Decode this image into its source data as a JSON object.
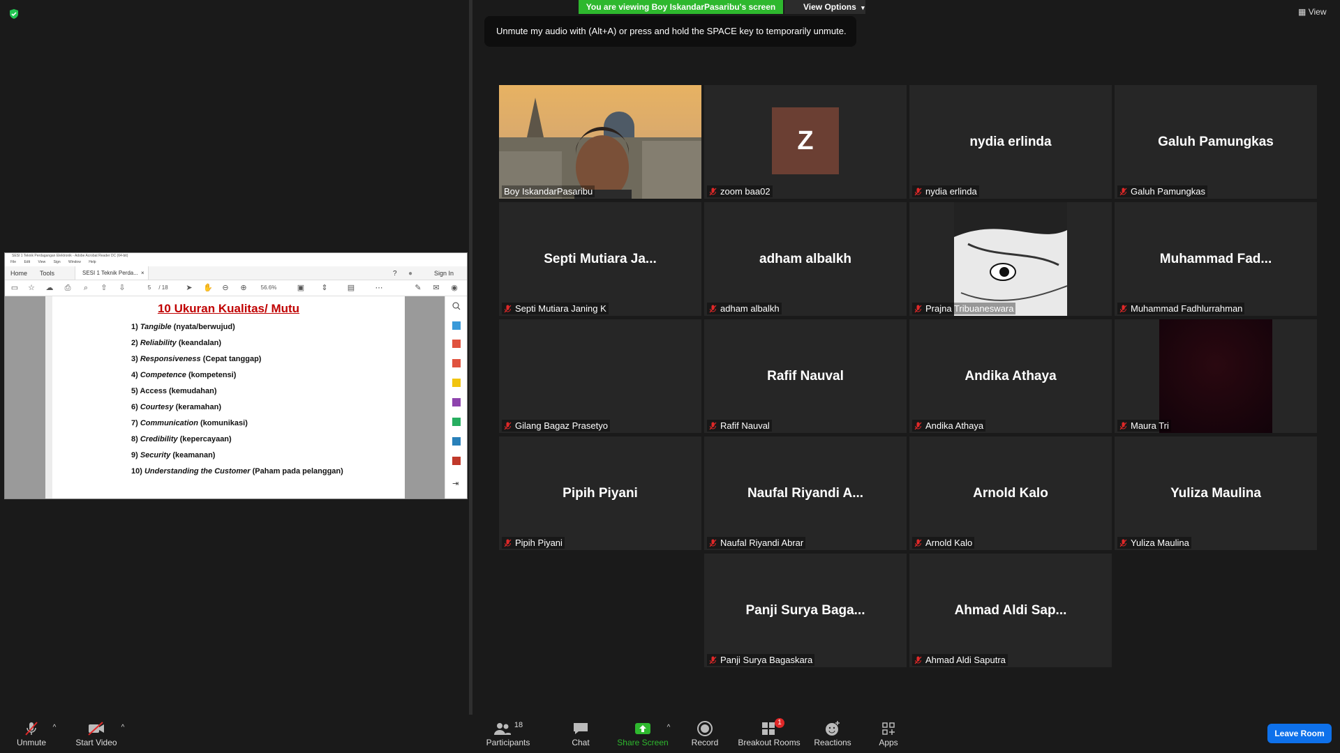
{
  "banner": {
    "viewing": "You are viewing Boy IskandarPasaribu's screen",
    "view_options": "View Options"
  },
  "toast": "Unmute my audio with (Alt+A) or press and hold the SPACE key to temporarily unmute.",
  "view_button": "View",
  "acrobat": {
    "window_title": "SESI 1 Teknik Perdagangan Elektronik - Adobe Acrobat Reader DC (64-bit)",
    "menu": [
      "File",
      "Edit",
      "View",
      "Sign",
      "Window",
      "Help"
    ],
    "tabs": {
      "home": "Home",
      "tools": "Tools",
      "document": "SESI 1 Teknik Perda...",
      "sign_in": "Sign In"
    },
    "page_current": "5",
    "page_total": "/ 18",
    "zoom": "56.6%"
  },
  "pdf": {
    "title": "10 Ukuran Kualitas/ Mutu",
    "items": [
      {
        "num": "1)",
        "term": "Tangible",
        "desc": "(nyata/berwujud)",
        "italic": true
      },
      {
        "num": "2)",
        "term": "Reliability",
        "desc": "(keandalan)",
        "italic": true
      },
      {
        "num": "3)",
        "term": "Responsiveness",
        "desc": "(Cepat tanggap)",
        "italic": true
      },
      {
        "num": "4)",
        "term": "Competence",
        "desc": "(kompetensi)",
        "italic": true
      },
      {
        "num": "5)",
        "term": "Access",
        "desc": "(kemudahan)",
        "italic": false
      },
      {
        "num": "6)",
        "term": "Courtesy",
        "desc": "(keramahan)",
        "italic": true
      },
      {
        "num": "7)",
        "term": "Communication",
        "desc": "(komunikasi)",
        "italic": true
      },
      {
        "num": "8)",
        "term": "Credibility",
        "desc": "(kepercayaan)",
        "italic": true
      },
      {
        "num": "9)",
        "term": "Security",
        "desc": "(keamanan)",
        "italic": true
      },
      {
        "num": "10)",
        "term": "Understanding the Customer",
        "desc": "(Paham pada pelanggan)",
        "italic": true
      }
    ]
  },
  "participants": [
    {
      "label": "Boy IskandarPasaribu",
      "big": "",
      "type": "video",
      "muted": false,
      "active": true
    },
    {
      "label": "zoom baa02",
      "big": "Z",
      "type": "avatar",
      "muted": true,
      "active": false
    },
    {
      "label": "nydia erlinda",
      "big": "nydia erlinda",
      "type": "name",
      "muted": true,
      "active": false
    },
    {
      "label": "Galuh Pamungkas",
      "big": "Galuh Pamungkas",
      "type": "name",
      "muted": true,
      "active": false
    },
    {
      "label": "Septi Mutiara Janing K",
      "big": "Septi Mutiara Ja...",
      "type": "name",
      "muted": true,
      "active": false
    },
    {
      "label": "adham albalkh",
      "big": "adham albalkh",
      "type": "name",
      "muted": true,
      "active": false
    },
    {
      "label": "Prajna Tribuaneswara",
      "big": "",
      "type": "manga",
      "muted": true,
      "active": false
    },
    {
      "label": "Muhammad Fadhlurrahman",
      "big": "Muhammad  Fad...",
      "type": "name",
      "muted": true,
      "active": false
    },
    {
      "label": "Gilang Bagaz Prasetyo",
      "big": "",
      "type": "blank",
      "muted": true,
      "active": false
    },
    {
      "label": "Rafif Nauval",
      "big": "Rafif Nauval",
      "type": "name",
      "muted": true,
      "active": false
    },
    {
      "label": "Andika Athaya",
      "big": "Andika Athaya",
      "type": "name",
      "muted": true,
      "active": false
    },
    {
      "label": "Maura Tri",
      "big": "",
      "type": "dark",
      "muted": true,
      "active": false
    },
    {
      "label": "Pipih Piyani",
      "big": "Pipih Piyani",
      "type": "name",
      "muted": true,
      "active": false
    },
    {
      "label": "Naufal Riyandi Abrar",
      "big": "Naufal  Riyandi  A...",
      "type": "name",
      "muted": true,
      "active": false
    },
    {
      "label": "Arnold Kalo",
      "big": "Arnold Kalo",
      "type": "name",
      "muted": true,
      "active": false
    },
    {
      "label": "Yuliza Maulina",
      "big": "Yuliza Maulina",
      "type": "name",
      "muted": true,
      "active": false
    },
    {
      "label": "Panji Surya Bagaskara",
      "big": "Panji Surya Baga...",
      "type": "name",
      "muted": true,
      "active": false
    },
    {
      "label": "Ahmad Aldi Saputra",
      "big": "Ahmad Aldi Sap...",
      "type": "name",
      "muted": true,
      "active": false
    }
  ],
  "toolbar": {
    "unmute": "Unmute",
    "start_video": "Start Video",
    "participants": "Participants",
    "participants_count": "18",
    "chat": "Chat",
    "share_screen": "Share Screen",
    "record": "Record",
    "breakout_rooms": "Breakout Rooms",
    "breakout_badge": "1",
    "reactions": "Reactions",
    "apps": "Apps",
    "leave": "Leave Room"
  },
  "colors": {
    "share_green": "#2eb82e",
    "leave_blue": "#0e71eb",
    "active_speaker": "#d8e84a",
    "muted_red": "#e02828",
    "pdf_title_red": "#c00000"
  },
  "icons": [
    "shield-icon",
    "microphone-muted-icon",
    "video-off-icon",
    "participants-icon",
    "chat-icon",
    "share-screen-icon",
    "record-icon",
    "breakout-rooms-icon",
    "reactions-icon",
    "apps-icon",
    "grid-view-icon"
  ]
}
